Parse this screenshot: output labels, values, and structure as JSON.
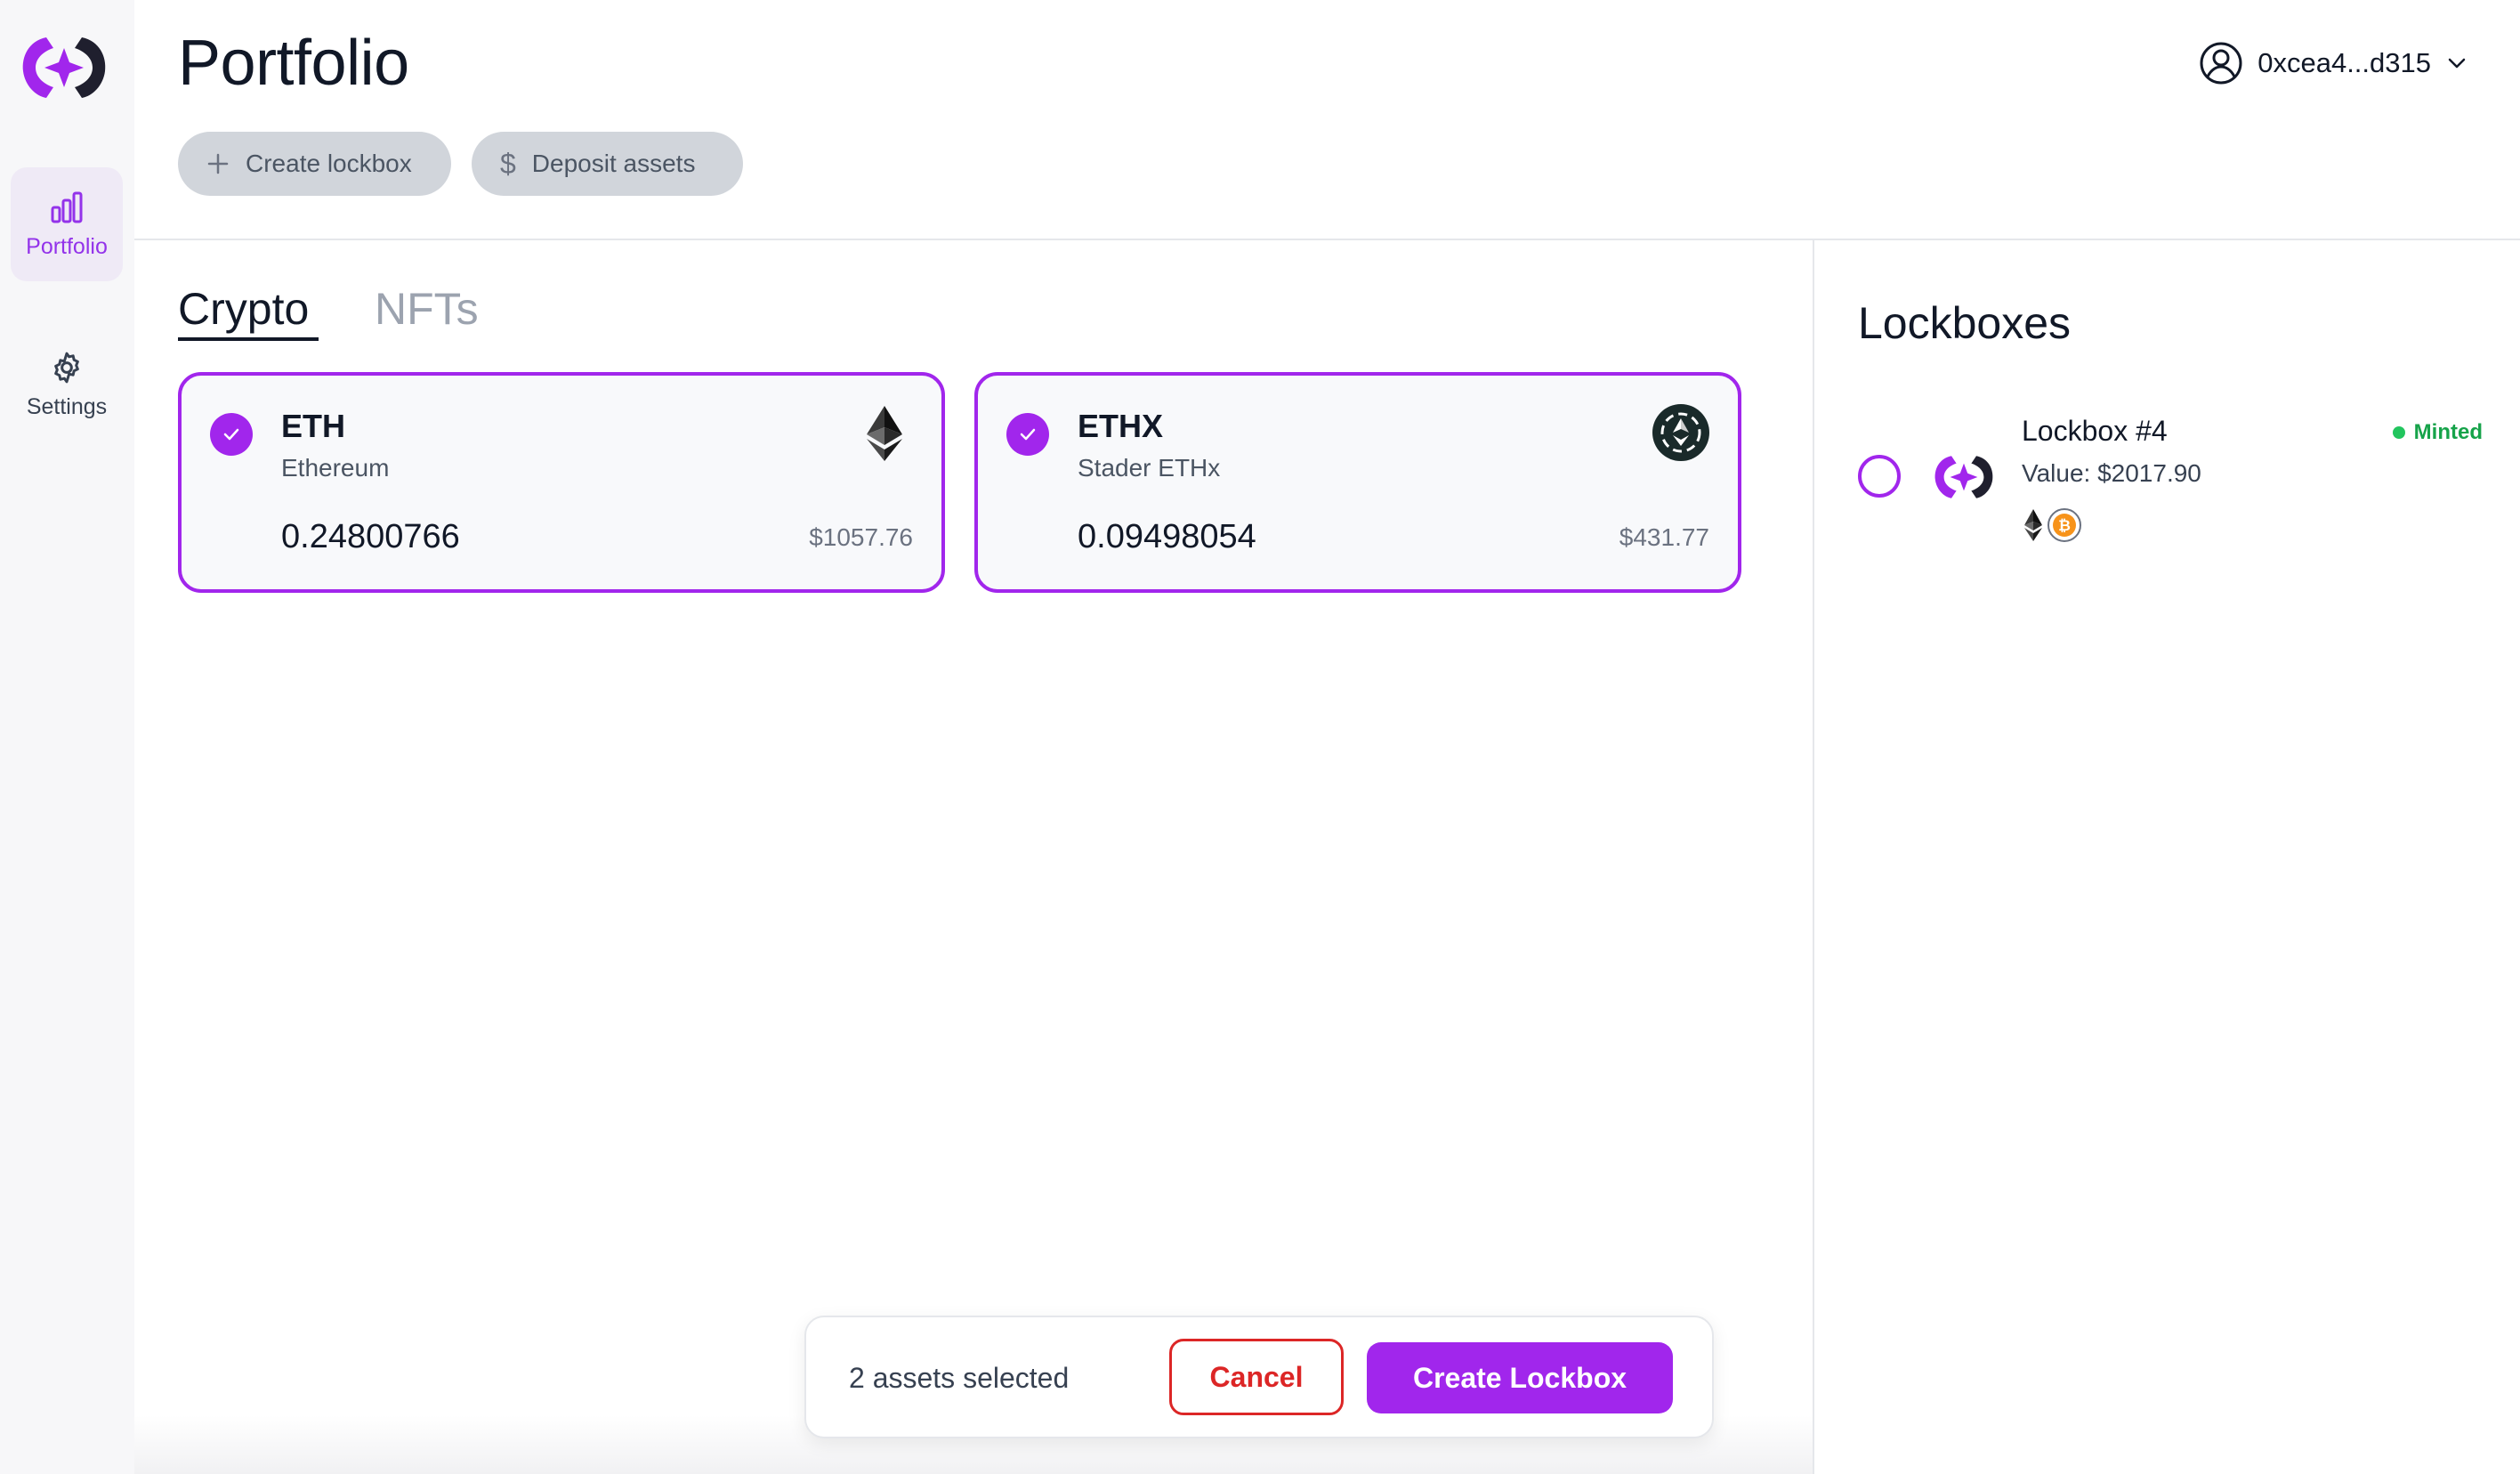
{
  "sidebar": {
    "items": [
      {
        "label": "Portfolio",
        "icon": "bar-chart-icon",
        "active": true
      },
      {
        "label": "Settings",
        "icon": "gear-icon",
        "active": false
      }
    ]
  },
  "header": {
    "title": "Portfolio",
    "create_lockbox_label": "Create lockbox",
    "deposit_assets_label": "Deposit assets",
    "wallet_address": "0xcea4...d315"
  },
  "tabs": [
    {
      "label": "Crypto",
      "active": true
    },
    {
      "label": "NFTs",
      "active": false
    }
  ],
  "assets": [
    {
      "symbol": "ETH",
      "name": "Ethereum",
      "amount": "0.24800766",
      "usd": "$1057.76",
      "selected": true,
      "icon": "ethereum-icon"
    },
    {
      "symbol": "ETHX",
      "name": "Stader ETHx",
      "amount": "0.09498054",
      "usd": "$431.77",
      "selected": true,
      "icon": "ethx-icon"
    }
  ],
  "lockboxes": {
    "title": "Lockboxes",
    "items": [
      {
        "name": "Lockbox #4",
        "value": "Value: $2017.90",
        "status": "Minted",
        "assets": [
          "ethereum-icon",
          "bitcoin-icon"
        ]
      }
    ]
  },
  "selection_bar": {
    "count_text": "2 assets selected",
    "cancel_label": "Cancel",
    "create_label": "Create Lockbox"
  },
  "colors": {
    "accent": "#a126ec",
    "cancel": "#dc2626",
    "minted": "#16a34a"
  }
}
